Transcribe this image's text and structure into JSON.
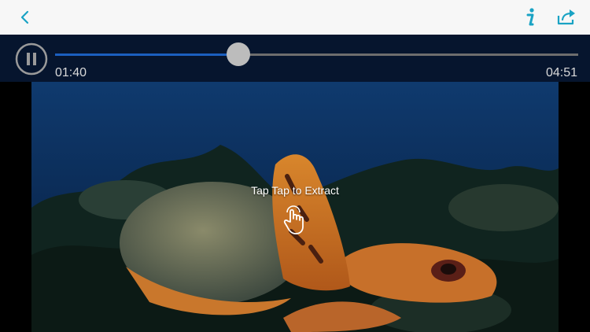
{
  "player": {
    "current_time": "01:40",
    "duration": "04:51",
    "progress": 0.35
  },
  "overlay": {
    "hint": "Tap Tap to Extract"
  },
  "colors": {
    "accent": "#1aa3c4",
    "nav_background": "#f7f7f7",
    "controls_background": "#061630",
    "progress_fill": "#1b5fbf"
  },
  "icons": {
    "back": "chevron-left-icon",
    "info": "info-icon",
    "share": "share-icon",
    "pause": "pause-icon",
    "tap": "tap-hand-icon"
  }
}
